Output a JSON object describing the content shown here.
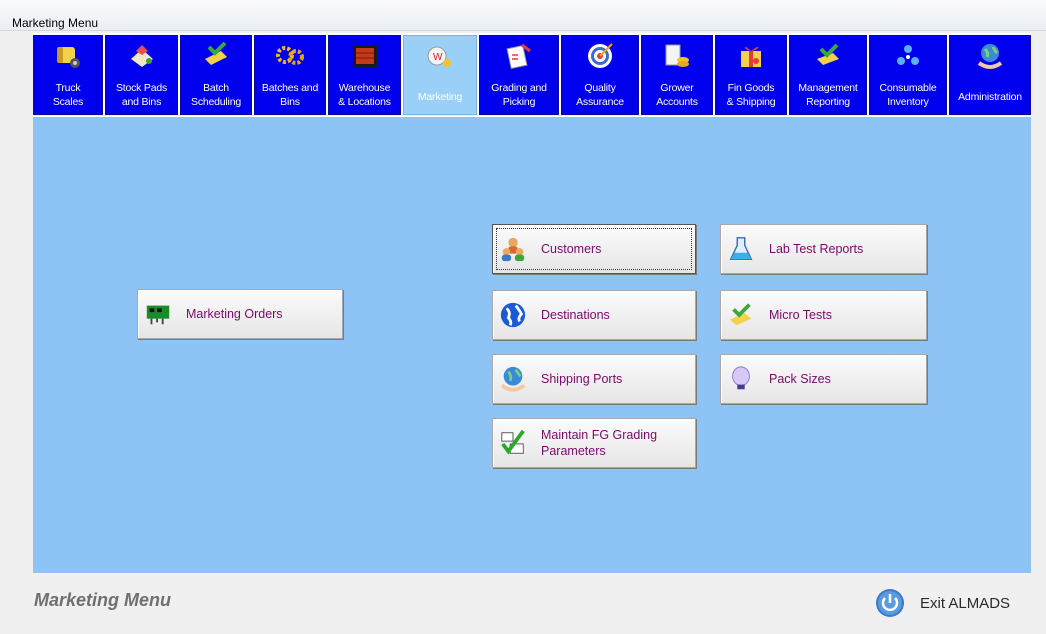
{
  "window": {
    "title": "Marketing Menu"
  },
  "nav": {
    "tabs": [
      {
        "label": "Truck\nScales",
        "icon": "truck-icon"
      },
      {
        "label": "Stock Pads\nand Bins",
        "icon": "stock-pads-icon"
      },
      {
        "label": "Batch\nScheduling",
        "icon": "batch-scheduling-icon"
      },
      {
        "label": "Batches and\nBins",
        "icon": "gears-icon"
      },
      {
        "label": "Warehouse\n& Locations",
        "icon": "warehouse-icon"
      },
      {
        "label": "Marketing",
        "icon": "marketing-icon",
        "active": true
      },
      {
        "label": "Grading and\nPicking",
        "icon": "grading-icon"
      },
      {
        "label": "Quality\nAssurance",
        "icon": "target-icon"
      },
      {
        "label": "Grower\nAccounts",
        "icon": "grower-accounts-icon"
      },
      {
        "label": "Fin Goods\n& Shipping",
        "icon": "gift-box-icon"
      },
      {
        "label": "Management\nReporting",
        "icon": "reporting-icon"
      },
      {
        "label": "Consumable\nInventory",
        "icon": "molecule-icon"
      },
      {
        "label": "Administration",
        "icon": "globe-hand-icon"
      }
    ]
  },
  "buttons": {
    "marketing_orders": "Marketing Orders",
    "customers": "Customers",
    "destinations": "Destinations",
    "shipping_ports": "Shipping Ports",
    "maintain_fg": "Maintain FG Grading\nParameters",
    "lab_test_reports": "Lab Test Reports",
    "micro_tests": "Micro Tests",
    "pack_sizes": "Pack Sizes"
  },
  "status": {
    "title": "Marketing Menu",
    "exit_label": "Exit ALMADS"
  },
  "colors": {
    "nav_tab": "#0000ee",
    "nav_tab_active": "#9ad0f8",
    "content_bg": "#8ec3f6",
    "button_text": "#7a0a6a"
  }
}
